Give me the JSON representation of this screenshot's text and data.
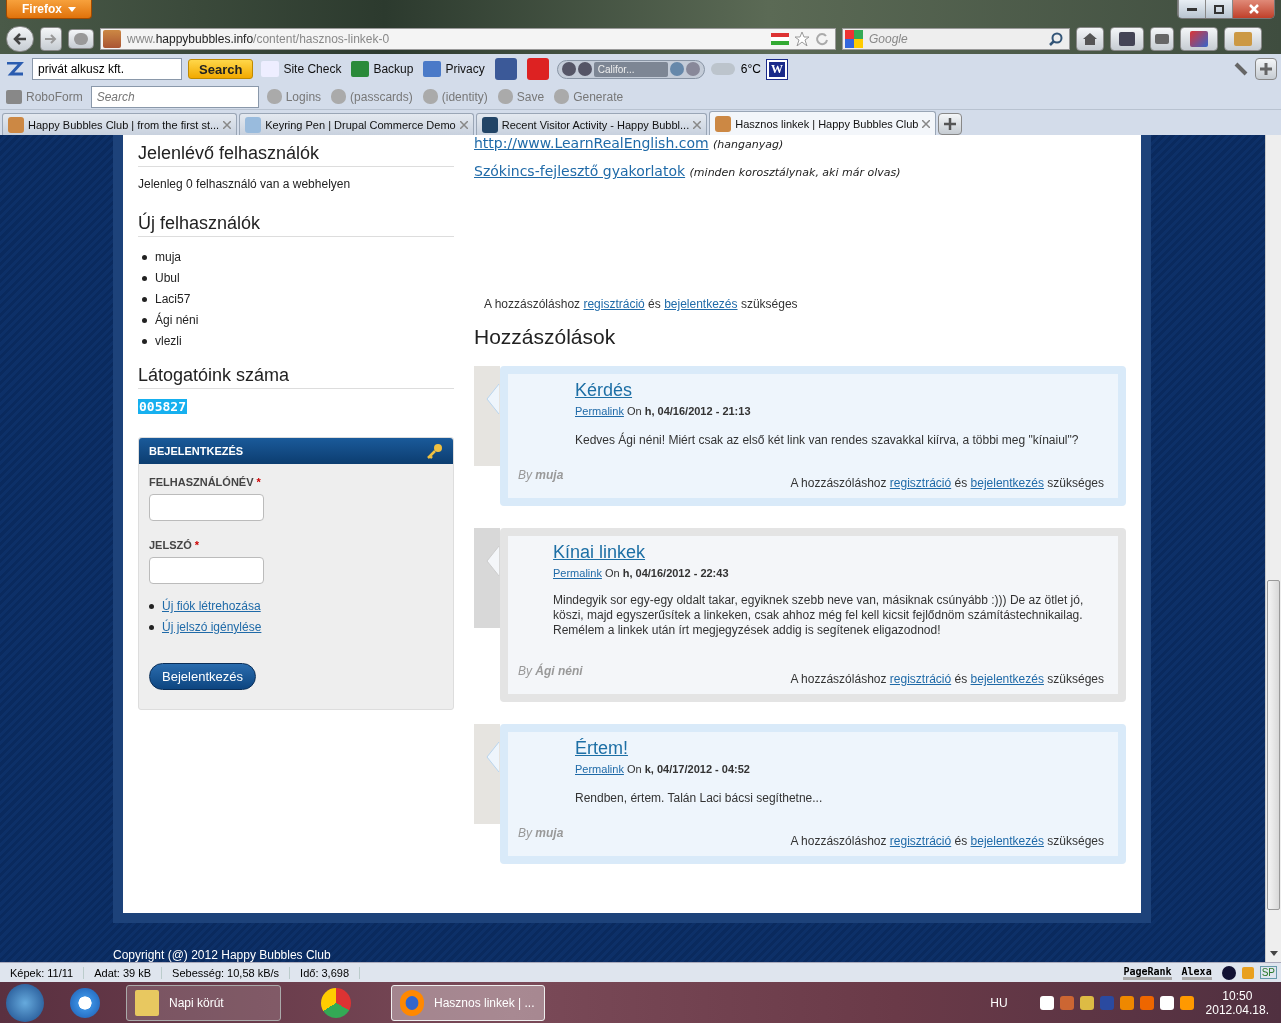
{
  "window": {
    "app_button": "Firefox"
  },
  "navbar": {
    "url_prefix": "www.",
    "url_host": "happybubbles.info",
    "url_path": "/content/hasznos-linkek-0",
    "search_placeholder": "Google"
  },
  "toolbar": {
    "search_value": "privát alkusz kft.",
    "search_button": "Search",
    "items": [
      "Site Check",
      "Backup",
      "Privacy"
    ],
    "station": "Califor...",
    "temperature": "6°C",
    "weather_badge": "W"
  },
  "roboform": {
    "label": "RoboForm",
    "search_placeholder": "Search",
    "items": [
      "Logins",
      "(passcards)",
      "(identity)",
      "Save",
      "Generate"
    ]
  },
  "tabs": [
    {
      "label": "Happy Bubbles Club | from the first st...",
      "selected": false
    },
    {
      "label": "Keyring Pen | Drupal Commerce Demo",
      "selected": false
    },
    {
      "label": "Recent Visitor Activity - Happy Bubbl...",
      "selected": false
    },
    {
      "label": "Hasznos linkek | Happy Bubbles Club",
      "selected": true
    }
  ],
  "sidebar": {
    "online": {
      "title": "Jelenlévő felhasználók",
      "text": "Jelenleg 0 felhasználó van a webhelyen"
    },
    "new_users": {
      "title": "Új felhasználók",
      "items": [
        "muja",
        "Ubul",
        "Laci57",
        "Ági néni",
        "vlezli"
      ]
    },
    "visitors": {
      "title": "Látogatóink száma",
      "counter": "005827"
    },
    "login": {
      "title": "BEJELENTKEZÉS",
      "fields": [
        {
          "label": "FELHASZNÁLÓNÉV",
          "required_mark": "*"
        },
        {
          "label": "JELSZÓ",
          "required_mark": "*"
        }
      ],
      "links": [
        "Új fiók létrehozása",
        "Új jelszó igénylése"
      ],
      "button": "Bejelentkezés"
    }
  },
  "main": {
    "links": [
      {
        "link": "http://www.LearnRealEnglish.com",
        "note": "(hanganyag)"
      },
      {
        "link": "Szókincs-fejlesztő gyakorlatok",
        "note": "(minden korosztálynak, aki már olvas)"
      }
    ],
    "notice": {
      "before": "A hozzászóláshoz",
      "link1": "regisztráció",
      "middle": "és",
      "link2": "bejelentkezés",
      "after": "szükséges"
    },
    "comments_title": "Hozzászólások",
    "comments": [
      {
        "kind": "member",
        "title": "Kérdés",
        "permalink": "Permalink",
        "on": "On",
        "date": "h, 04/16/2012 - 21:13",
        "body": "Kedves Ági néni! Miért csak az első két link van rendes szavakkal kiírva, a többi meg \"kínaiul\"?",
        "by": "By",
        "author": "muja",
        "notice": {
          "before": "A hozzászóláshoz",
          "link1": "regisztráció",
          "middle": "és",
          "link2": "bejelentkezés",
          "after": "szükséges"
        }
      },
      {
        "kind": "author",
        "title": "Kínai linkek",
        "permalink": "Permalink",
        "on": "On",
        "date": "h, 04/16/2012 - 22:43",
        "body": "Mindegyik sor egy-egy oldalt takar, egyiknek szebb neve van, másiknak csúnyább :))) De az ötlet jó, köszi, majd egyszerűsítek a linkeken, csak ahhoz még fel kell kicsit fejlődnöm számítástechnikailag. Remélem a linkek után írt megjegyzések addig is segítenek eligazodnod!",
        "by": "By",
        "author": "Ági néni",
        "notice": {
          "before": "A hozzászóláshoz",
          "link1": "regisztráció",
          "middle": "és",
          "link2": "bejelentkezés",
          "after": "szükséges"
        }
      },
      {
        "kind": "member",
        "title": "Értem!",
        "permalink": "Permalink",
        "on": "On",
        "date": "k, 04/17/2012 - 04:52",
        "body": "Rendben, értem. Talán Laci bácsi segíthetne...",
        "by": "By",
        "author": "muja",
        "notice": {
          "before": "A hozzászóláshoz",
          "link1": "regisztráció",
          "middle": "és",
          "link2": "bejelentkezés",
          "after": "szükséges"
        }
      }
    ]
  },
  "footer": {
    "copyright": "Copyright (@) 2012 Happy Bubbles Club"
  },
  "status_bar": {
    "items": [
      "Képek: 11/11",
      "Adat: 39 kB",
      "Sebesség: 10,58 kB/s",
      "Idő: 3,698"
    ],
    "pagerank": "PageRank",
    "alexa": "Alexa",
    "badge": "SP"
  },
  "taskbar": {
    "buttons": [
      {
        "label": "Napi körút",
        "selected": false
      },
      {
        "label": "Hasznos linkek | ...",
        "selected": true
      }
    ],
    "language": "HU",
    "time": "10:50",
    "date": "2012.04.18."
  }
}
